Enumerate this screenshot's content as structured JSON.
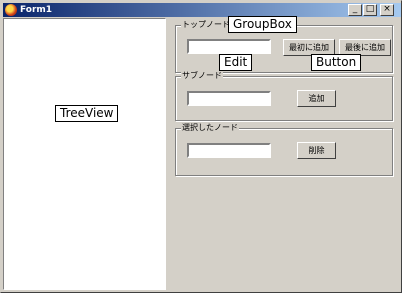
{
  "window": {
    "title": "Form1",
    "controls": [
      "_",
      "□",
      "×"
    ]
  },
  "groups": {
    "top": {
      "caption": "トップノード",
      "btn_first": "最初に追加",
      "btn_last": "最後に追加"
    },
    "sub": {
      "caption": "サブノード",
      "btn_add": "追加"
    },
    "selected": {
      "caption": "選択したノード",
      "btn_delete": "削除"
    }
  },
  "callouts": {
    "groupbox": "GroupBox",
    "edit": "Edit",
    "button": "Button",
    "treeview": "TreeView"
  }
}
